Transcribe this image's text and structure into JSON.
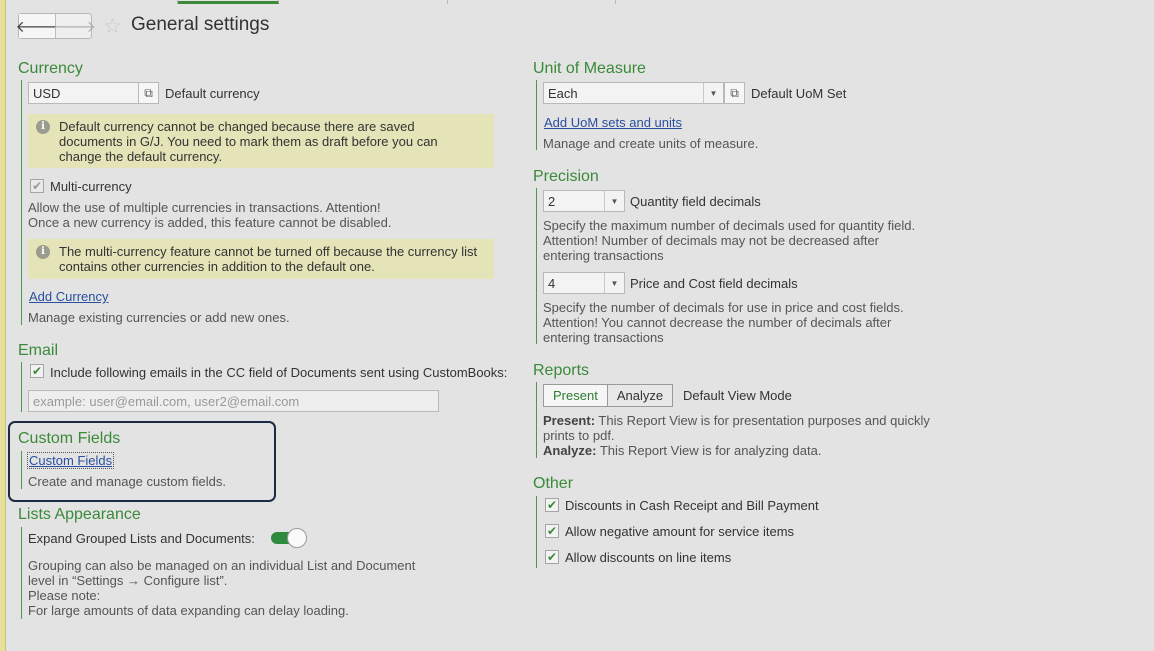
{
  "header": {
    "title": "General settings",
    "back_glyph": "🡐",
    "forward_glyph": "🡒",
    "star_glyph": "☆"
  },
  "currency": {
    "title": "Currency",
    "value": "USD",
    "label": "Default currency",
    "note": [
      "Default currency cannot be changed because there are saved",
      "documents in G/J. You need to mark them as draft before you can",
      "change the default currency."
    ],
    "multi_label": "Multi-currency",
    "multi_desc": [
      "Allow the use of multiple currencies in transactions.   Attention!",
      "Once a new currency is added, this feature cannot be disabled."
    ],
    "note2": [
      "The multi-currency feature cannot be turned off because the currency list",
      "contains other currencies in addition to the default one."
    ],
    "add_link": "Add Currency",
    "manage_desc": "Manage existing currencies or add new ones."
  },
  "email": {
    "title": "Email",
    "cc_label": "Include following emails in the CC field of Documents sent using CustomBooks:",
    "placeholder": "example: user@email.com, user2@email.com"
  },
  "custom_fields": {
    "title": "Custom Fields",
    "link": "Custom Fields",
    "desc": "Create and manage custom fields."
  },
  "lists": {
    "title": "Lists Appearance",
    "toggle_label": "Expand Grouped Lists and Documents:",
    "desc": [
      "Grouping can also be managed on an individual List and Document",
      "level in “Settings → Configure list”.",
      "Please note:",
      "For large amounts of data expanding can delay loading."
    ]
  },
  "uom": {
    "title": "Unit of Measure",
    "value": "Each",
    "label": "Default UoM Set",
    "link": "Add UoM sets and units",
    "desc": "Manage and create units of measure."
  },
  "precision": {
    "title": "Precision",
    "qty_value": "2",
    "qty_label": "Quantity field decimals",
    "qty_desc": [
      "Specify the maximum number of decimals used for quantity field.",
      "Attention! Number of decimals may not be decreased after",
      "entering transactions"
    ],
    "price_value": "4",
    "price_label": "Price and Cost field decimals",
    "price_desc": [
      "Specify the number of decimals for use in price and cost fields.",
      "Attention!  You cannot decrease the number of decimals after",
      "entering transactions"
    ]
  },
  "reports": {
    "title": "Reports",
    "present": "Present",
    "analyze": "Analyze",
    "mode_label": "Default View Mode",
    "present_b": "Present:",
    "present_desc1": " This Report View is for presentation purposes and quickly",
    "present_desc2": "prints to pdf.",
    "analyze_b": "Analyze:",
    "analyze_desc": " This Report View is for analyzing data."
  },
  "other": {
    "title": "Other",
    "items": [
      "Discounts in Cash Receipt and Bill Payment",
      "Allow negative amount for service items",
      "Allow discounts on line items"
    ]
  },
  "glyphs": {
    "check": "✔",
    "open": "⧉",
    "dropdown": "▼",
    "info": "i"
  }
}
